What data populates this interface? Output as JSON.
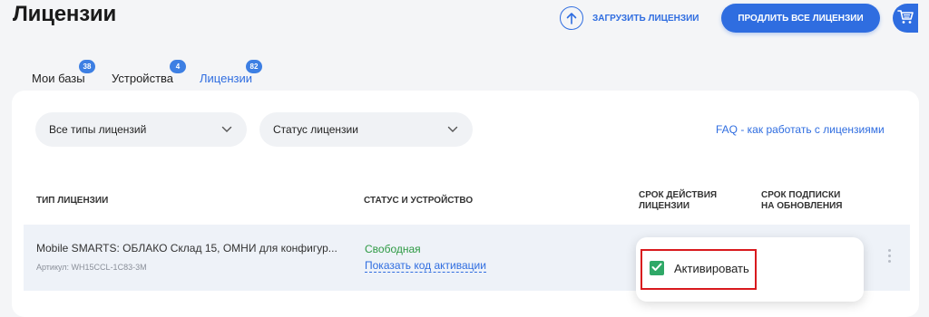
{
  "header": {
    "title": "Лицензии",
    "upload_label": "ЗАГРУЗИТЬ ЛИЦЕНЗИИ",
    "renew_label": "ПРОДЛИТЬ ВСЕ ЛИЦЕНЗИИ",
    "accent_color": "#2f6de0"
  },
  "tabs": [
    {
      "label": "Мои базы",
      "count": "38",
      "active": false
    },
    {
      "label": "Устройства",
      "count": "4",
      "active": false
    },
    {
      "label": "Лицензии",
      "count": "82",
      "active": true
    }
  ],
  "filters": {
    "license_type": "Все типы лицензий",
    "license_status": "Статус лицензии",
    "faq_link": "FAQ - как работать с лицензиями"
  },
  "table": {
    "columns": [
      "ТИП ЛИЦЕНЗИИ",
      "СТАТУС И УСТРОЙСТВО",
      "СРОК ДЕЙСТВИЯ ЛИЦЕНЗИИ",
      "СРОК ПОДПИСКИ НА ОБНОВЛЕНИЯ"
    ],
    "rows": [
      {
        "name": "Mobile SMARTS: ОБЛАКО Склад 15, ОМНИ для конфигур...",
        "sku": "Артикул: WH15CCL-1C83-3M",
        "status": "Свободная",
        "activation_link": "Показать код активации",
        "status_color": "#2e9a44"
      }
    ]
  },
  "popup": {
    "activate_label": "Активировать",
    "checked": true,
    "highlight_color": "#d9191e"
  },
  "icons": [
    "upload-icon",
    "cart-icon",
    "chevron-down-icon",
    "check-icon",
    "kebab-menu-icon"
  ]
}
